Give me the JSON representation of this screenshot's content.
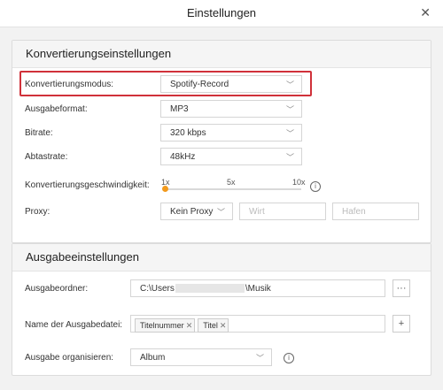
{
  "window": {
    "title": "Einstellungen",
    "close_icon": "✕"
  },
  "conversion": {
    "header": "Konvertierungseinstellungen",
    "mode": {
      "label": "Konvertierungsmodus:",
      "value": "Spotify-Record"
    },
    "format": {
      "label": "Ausgabeformat:",
      "value": "MP3"
    },
    "bitrate": {
      "label": "Bitrate:",
      "value": "320 kbps"
    },
    "samplerate": {
      "label": "Abtastrate:",
      "value": "48kHz"
    },
    "speed": {
      "label": "Konvertierungsgeschwindigkeit:",
      "ticks": [
        "1x",
        "5x",
        "10x"
      ],
      "value": "1x"
    },
    "proxy": {
      "label": "Proxy:",
      "value": "Kein Proxy",
      "host_placeholder": "Wirt",
      "port_placeholder": "Hafen"
    }
  },
  "output": {
    "header": "Ausgabeeinstellungen",
    "folder": {
      "label": "Ausgabeordner:",
      "prefix": "C:\\Users",
      "suffix": "\\Musik",
      "browse": "···"
    },
    "filename": {
      "label": "Name der Ausgabedatei:",
      "tags": [
        "Titelnummer",
        "Titel"
      ],
      "add": "+"
    },
    "organize": {
      "label": "Ausgabe organisieren:",
      "value": "Album"
    }
  },
  "icons": {
    "chevron": "chevron-down-icon",
    "info": "info-icon",
    "close": "close-icon"
  },
  "colors": {
    "highlight": "#d0313a",
    "slider": "#f29a1d"
  }
}
